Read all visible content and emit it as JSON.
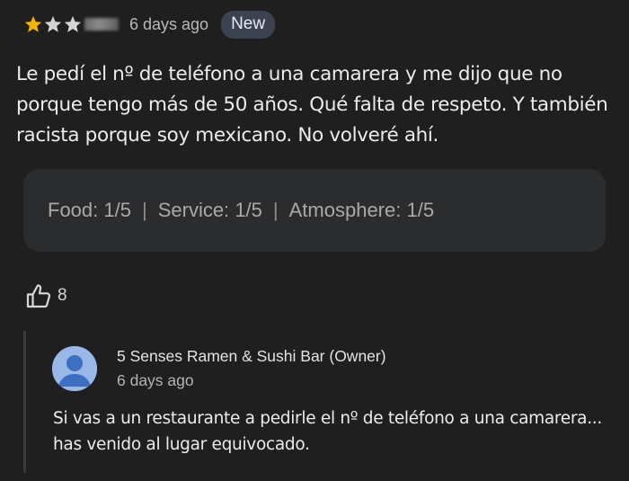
{
  "review": {
    "rating": 3,
    "max_rating": 5,
    "star_color": "#f4b400",
    "star_empty_color": "#5f6368",
    "time": "6 days ago",
    "badge": "New",
    "text": "Le pedí el nº de teléfono a una camarera y me dijo que no porque tengo más de 50 años. Qué falta de respeto. Y también racista porque soy mexicano. No volveré ahí.",
    "ratings": {
      "food_label": "Food:",
      "food_value": "1/5",
      "service_label": "Service:",
      "service_value": "1/5",
      "atmosphere_label": "Atmosphere:",
      "atmosphere_value": "1/5",
      "separator": "|"
    },
    "likes": "8"
  },
  "reply": {
    "owner_name": "5 Senses Ramen & Sushi Bar (Owner)",
    "time": "6 days ago",
    "text": "Si vas a un restaurante a pedirle el nº de teléfono a una camarera... has venido al lugar equivocado.",
    "avatar_color": "#99b8e8"
  }
}
